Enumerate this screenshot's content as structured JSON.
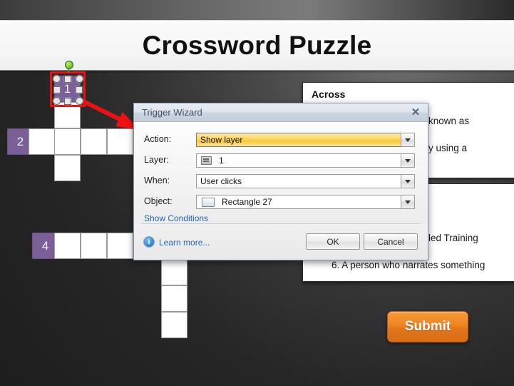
{
  "slide": {
    "title": "Crossword Puzzle",
    "submit_label": "Submit"
  },
  "grid": {
    "numbers": {
      "n1": "1",
      "n2": "2",
      "n4": "4"
    }
  },
  "across_panel": {
    "heading": "Across",
    "clues": [
      "ularly known as",
      "ovie by using a"
    ]
  },
  "down_panel": {
    "clues": [
      "led Training",
      "6. A person who narrates something"
    ]
  },
  "dialog": {
    "title": "Trigger Wizard",
    "close_glyph": "✕",
    "fields": {
      "action": {
        "label": "Action:",
        "value": "Show layer"
      },
      "layer": {
        "label": "Layer:",
        "value": "1"
      },
      "when": {
        "label": "When:",
        "value": "User clicks"
      },
      "object": {
        "label": "Object:",
        "value": "Rectangle 27"
      }
    },
    "show_conditions_label": "Show Conditions",
    "learn_more_label": "Learn more...",
    "info_glyph": "i",
    "ok_label": "OK",
    "cancel_label": "Cancel"
  },
  "colors": {
    "accent_orange": "#ef8521",
    "cell_purple": "#7a6096",
    "annotation_red": "#ee1111",
    "highlight_yellow": "#ffd864",
    "link_blue": "#2663b0"
  }
}
